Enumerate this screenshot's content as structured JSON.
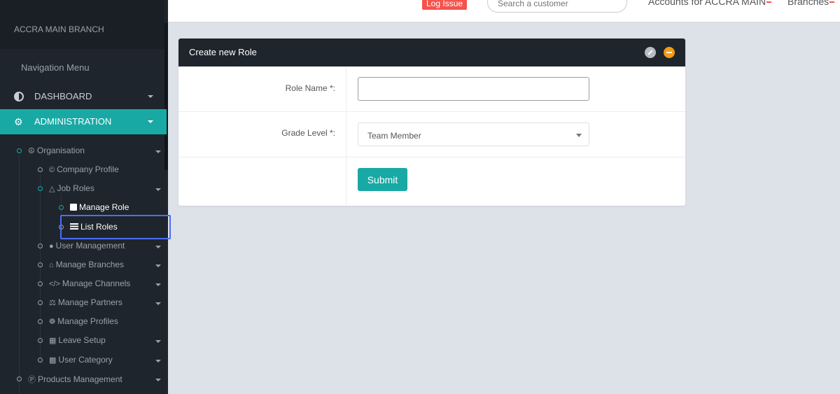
{
  "topbar": {
    "log_issue": "Log Issue",
    "search_placeholder": "Search a customer",
    "accounts_link": "Accounts for ACCRA MAIN",
    "branches_link": "Branches"
  },
  "sidebar": {
    "branch_name": "ACCRA MAIN BRANCH",
    "nav_title": "Navigation Menu",
    "dashboard": "DASHBOARD",
    "administration": "ADMINISTRATION",
    "items": [
      {
        "label": "Organisation",
        "icon": "bank-icon"
      },
      {
        "label": "Company Profile",
        "icon": "copyright-icon"
      },
      {
        "label": "Job Roles",
        "icon": "graduation-cap-icon"
      },
      {
        "label": "Manage Role",
        "icon": "edit-icon"
      },
      {
        "label": "List Roles",
        "icon": "list-icon"
      },
      {
        "label": "User Management",
        "icon": "user-icon"
      },
      {
        "label": "Manage Branches",
        "icon": "home-icon"
      },
      {
        "label": "Manage Channels",
        "icon": "code-icon"
      },
      {
        "label": "Manage Partners",
        "icon": "balance-scale-icon"
      },
      {
        "label": "Manage Profiles",
        "icon": "gear-outline-icon"
      },
      {
        "label": "Leave Setup",
        "icon": "map-icon"
      },
      {
        "label": "User Category",
        "icon": "category-icon"
      },
      {
        "label": "Products Management",
        "icon": "product-icon"
      }
    ]
  },
  "panel": {
    "title": "Create new Role",
    "role_name_label": "Role Name *:",
    "role_name_value": "",
    "grade_level_label": "Grade Level *:",
    "grade_level_value": "Team Member",
    "submit_label": "Submit"
  },
  "colors": {
    "accent": "#18a9a5",
    "sidebar_bg": "#1f252c",
    "badge": "#f5534d",
    "collapse_btn": "#f39c12",
    "highlight": "#4c6ef5"
  }
}
